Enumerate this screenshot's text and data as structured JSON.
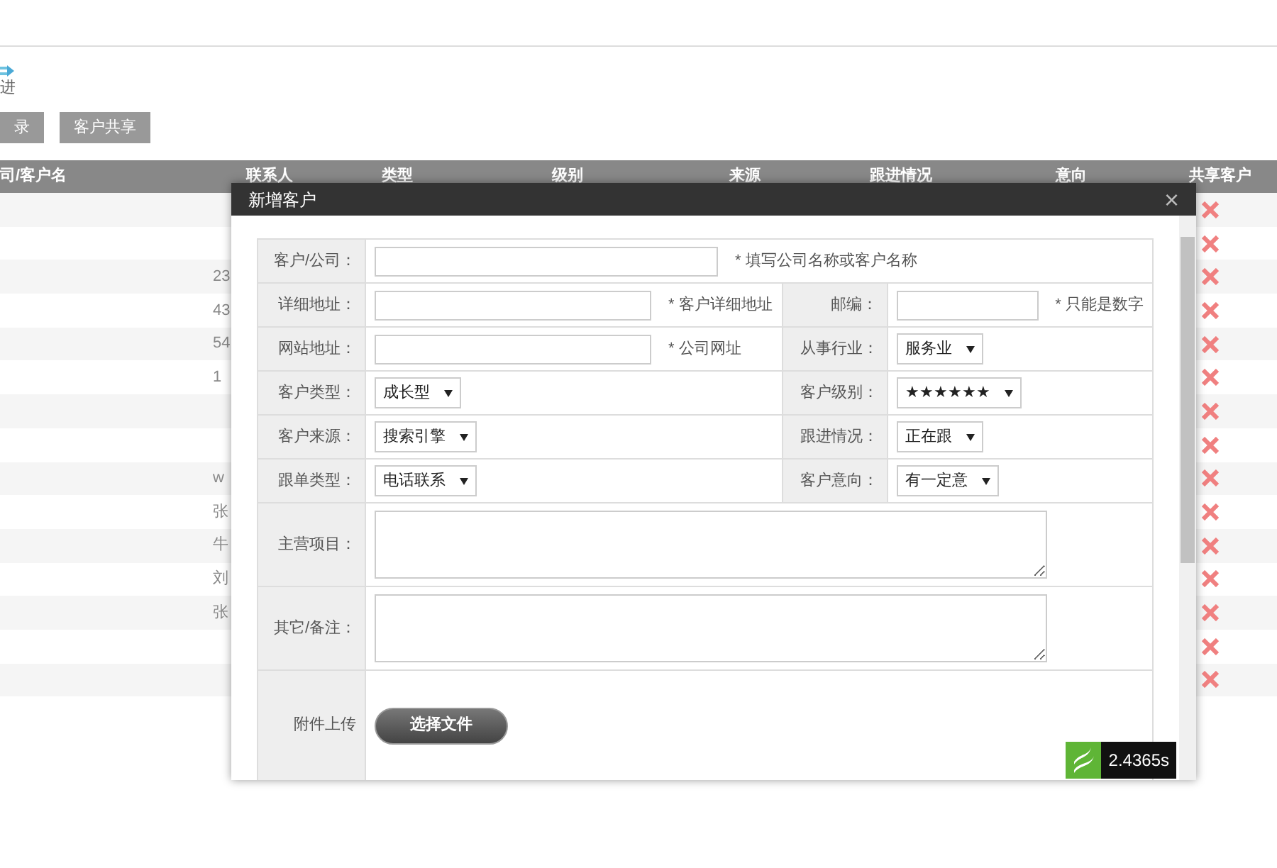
{
  "toolbar": {
    "follow_label": "进",
    "buttons": [
      "录",
      "客户共享"
    ]
  },
  "table": {
    "columns": [
      "司/客户名",
      "联系人",
      "类型",
      "级别",
      "来源",
      "跟进情况",
      "意向",
      "共享客户"
    ],
    "rows": [
      {
        "contact": ""
      },
      {
        "contact": ""
      },
      {
        "contact": "23"
      },
      {
        "contact": "43"
      },
      {
        "contact": "54"
      },
      {
        "contact": "1"
      },
      {
        "contact": ""
      },
      {
        "contact": ""
      },
      {
        "contact": "w"
      },
      {
        "contact": "张"
      },
      {
        "contact": "牛"
      },
      {
        "contact": "刘"
      },
      {
        "contact": "张"
      },
      {
        "contact": ""
      },
      {
        "contact": ""
      }
    ]
  },
  "dialog": {
    "title": "新增客户",
    "close": "×",
    "rows": [
      [
        {
          "label": "客户/公司：",
          "kind": "text",
          "hint": "* 填写公司名称或客户名称"
        }
      ],
      [
        {
          "label": "详细地址：",
          "kind": "text",
          "hint": "* 客户详细地址"
        },
        {
          "label": "邮编：",
          "kind": "text",
          "hint": "* 只能是数字"
        }
      ],
      [
        {
          "label": "网站地址：",
          "kind": "text",
          "hint": "* 公司网址"
        },
        {
          "label": "从事行业：",
          "kind": "select",
          "value": "服务业"
        }
      ],
      [
        {
          "label": "客户类型：",
          "kind": "select",
          "value": "成长型"
        },
        {
          "label": "客户级别：",
          "kind": "select",
          "value": "★★★★★★"
        }
      ],
      [
        {
          "label": "客户来源：",
          "kind": "select",
          "value": "搜索引擎"
        },
        {
          "label": "跟进情况：",
          "kind": "select",
          "value": "正在跟"
        }
      ],
      [
        {
          "label": "跟单类型：",
          "kind": "select",
          "value": "电话联系"
        },
        {
          "label": "客户意向：",
          "kind": "select",
          "value": "有一定意"
        }
      ],
      [
        {
          "label": "主营项目：",
          "kind": "textarea"
        }
      ],
      [
        {
          "label": "其它/备注：",
          "kind": "textarea"
        }
      ],
      [
        {
          "label": "附件上传",
          "kind": "file",
          "value": "选择文件"
        }
      ]
    ]
  },
  "timer": {
    "value": "2.4365s"
  }
}
